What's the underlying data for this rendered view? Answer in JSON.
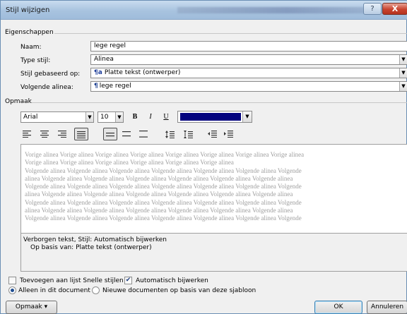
{
  "window": {
    "title": "Stijl wijzigen",
    "help_label": "?",
    "close_label": "X"
  },
  "properties": {
    "group_label": "Eigenschappen",
    "name_label": "Naam:",
    "name_value": "lege regel",
    "type_label": "Type stijl:",
    "type_value": "Alinea",
    "based_on_label": "Stijl gebaseerd op:",
    "based_on_glyph": "¶a",
    "based_on_value": "Platte tekst (ontwerper)",
    "next_label": "Volgende alinea:",
    "next_glyph": "¶",
    "next_value": "lege regel"
  },
  "format": {
    "group_label": "Opmaak",
    "font": "Arial",
    "size": "10",
    "bold_label": "B",
    "italic_label": "I",
    "underline_label": "U",
    "text_color": "#00007e"
  },
  "preview": {
    "lines": [
      "Vorige alinea Vorige alinea Vorige alinea Vorige alinea Vorige alinea Vorige alinea Vorige alinea Vorige alinea",
      "Vorige alinea Vorige alinea Vorige alinea Vorige alinea Vorige alinea Vorige alinea",
      "Volgende alinea Volgende alinea Volgende alinea Volgende alinea Volgende alinea Volgende alinea Volgende",
      "alinea Volgende alinea Volgende alinea Volgende alinea Volgende alinea Volgende alinea Volgende alinea",
      "Volgende alinea Volgende alinea Volgende alinea Volgende alinea Volgende alinea Volgende alinea Volgende",
      "alinea Volgende alinea Volgende alinea Volgende alinea Volgende alinea Volgende alinea Volgende alinea",
      "Volgende alinea Volgende alinea Volgende alinea Volgende alinea Volgende alinea Volgende alinea Volgende",
      "alinea Volgende alinea Volgende alinea Volgende alinea Volgende alinea Volgende alinea Volgende alinea",
      "Volgende alinea Volgende alinea Volgende alinea Volgende alinea Volgende alinea Volgende alinea Volgende"
    ]
  },
  "description": {
    "line1": "Verborgen tekst, Stijl: Automatisch bijwerken",
    "line2": "Op basis van: Platte tekst (ontwerper)"
  },
  "options": {
    "add_quick_styles_label": "Toevoegen aan lijst Snelle stijlen",
    "add_quick_styles_checked": false,
    "auto_update_label": "Automatisch bijwerken",
    "auto_update_checked": true,
    "only_this_doc_label": "Alleen in dit document",
    "only_this_doc_selected": true,
    "new_docs_label": "Nieuwe documenten op basis van deze sjabloon",
    "new_docs_selected": false
  },
  "buttons": {
    "format_menu": "Opmaak ▾",
    "ok": "OK",
    "cancel": "Annuleren"
  }
}
